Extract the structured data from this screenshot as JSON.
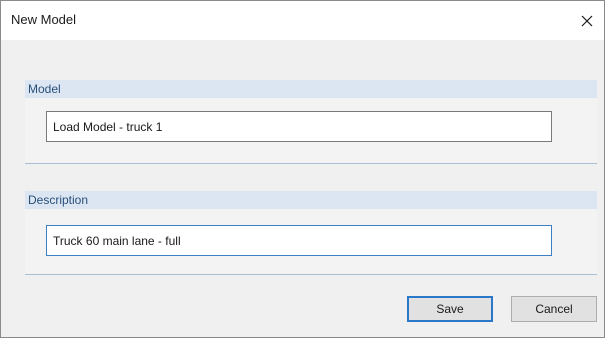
{
  "window": {
    "title": "New Model",
    "close_icon": "close-icon"
  },
  "model_group": {
    "label": "Model",
    "value": "Load Model - truck 1"
  },
  "description_group": {
    "label": "Description",
    "value": "Truck 60 main lane - full"
  },
  "buttons": {
    "save_label": "Save",
    "cancel_label": "Cancel"
  },
  "colors": {
    "group_header_bg": "#dbe6f2",
    "group_header_text": "#2a4f7a",
    "focus_border": "#3c7fc4",
    "default_button_border": "#2c78c8"
  }
}
